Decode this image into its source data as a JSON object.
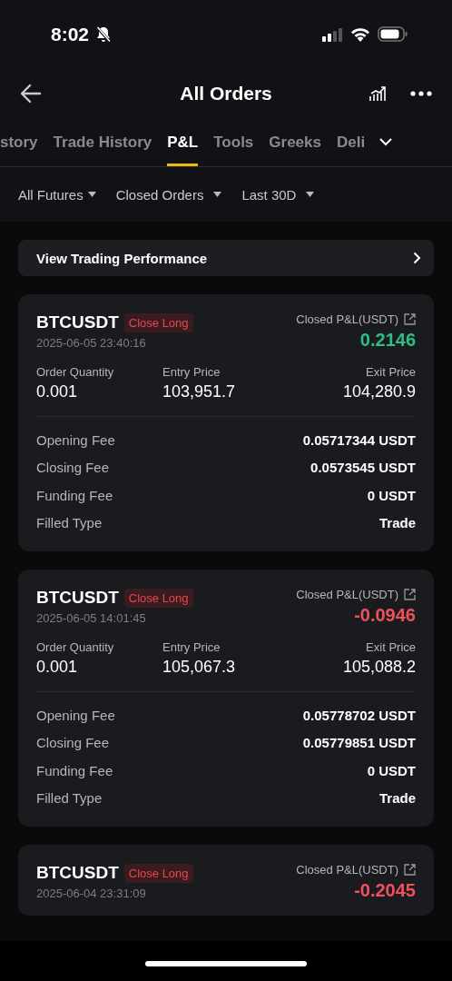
{
  "status_bar": {
    "time": "8:02"
  },
  "header": {
    "title": "All Orders"
  },
  "tabs": [
    {
      "label": "story",
      "selected": false
    },
    {
      "label": "Trade History",
      "selected": false
    },
    {
      "label": "P&L",
      "selected": true
    },
    {
      "label": "Tools",
      "selected": false
    },
    {
      "label": "Greeks",
      "selected": false
    },
    {
      "label": "Deli",
      "selected": false
    }
  ],
  "filters": [
    "All Futures",
    "Closed Orders",
    "Last 30D"
  ],
  "performance_link": "View Trading Performance",
  "orders": [
    {
      "symbol": "BTCUSDT",
      "tag": "Close Long",
      "time": "2025-06-05 23:40:16",
      "pnl_label": "Closed P&L(USDT)",
      "pnl": "0.2146",
      "color": "#2ebd85",
      "stats": [
        {
          "label": "Order Quantity",
          "value": "0.001"
        },
        {
          "label": "Entry Price",
          "value": "103,951.7"
        },
        {
          "label": "Exit Price",
          "value": "104,280.9"
        }
      ],
      "fees": [
        {
          "label": "Opening Fee",
          "value": "0.05717344 USDT"
        },
        {
          "label": "Closing Fee",
          "value": "0.0573545 USDT"
        },
        {
          "label": "Funding Fee",
          "value": "0 USDT"
        },
        {
          "label": "Filled Type",
          "value": "Trade"
        }
      ]
    },
    {
      "symbol": "BTCUSDT",
      "tag": "Close Long",
      "time": "2025-06-05 14:01:45",
      "pnl_label": "Closed P&L(USDT)",
      "pnl": "-0.0946",
      "color": "#f0505e",
      "stats": [
        {
          "label": "Order Quantity",
          "value": "0.001"
        },
        {
          "label": "Entry Price",
          "value": "105,067.3"
        },
        {
          "label": "Exit Price",
          "value": "105,088.2"
        }
      ],
      "fees": [
        {
          "label": "Opening Fee",
          "value": "0.05778702 USDT"
        },
        {
          "label": "Closing Fee",
          "value": "0.05779851 USDT"
        },
        {
          "label": "Funding Fee",
          "value": "0 USDT"
        },
        {
          "label": "Filled Type",
          "value": "Trade"
        }
      ]
    },
    {
      "symbol": "BTCUSDT",
      "tag": "Close Long",
      "time": "2025-06-04 23:31:09",
      "pnl_label": "Closed P&L(USDT)",
      "pnl": "-0.2045",
      "color": "#f0505e"
    }
  ]
}
